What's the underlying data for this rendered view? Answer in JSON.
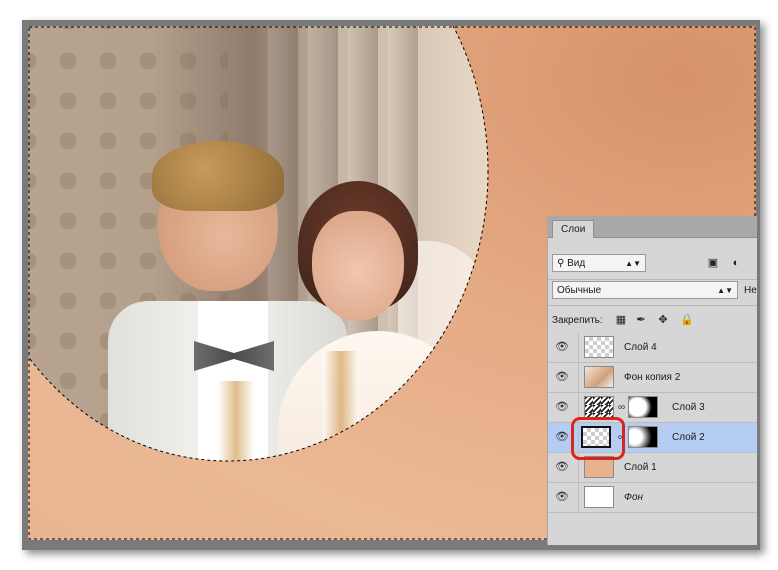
{
  "colors": {
    "highlight": "#d9261c",
    "selected_row": "#b5cdf3",
    "panel_bg": "#d6d6d6",
    "canvas_bg": "#e9b491"
  },
  "panel": {
    "tab_label": "Слои",
    "filter_label": "Вид",
    "blend_mode": "Обычные",
    "opacity_label_partial": "Не",
    "lock_label": "Закрепить:",
    "layers": [
      {
        "name": "Слой 4",
        "thumb": "checker",
        "selected": false,
        "italic": false,
        "icon": "eye-icon"
      },
      {
        "name": "Фон копия 2",
        "thumb": "photo",
        "selected": false,
        "italic": false,
        "icon": "eye-icon"
      },
      {
        "name": "Слой 3",
        "thumb": "pattern-with-mask",
        "selected": false,
        "italic": false,
        "icon": "eye-icon"
      },
      {
        "name": "Слой 2",
        "thumb": "checker-with-mask",
        "selected": true,
        "italic": false,
        "icon": "eye-icon"
      },
      {
        "name": "Слой 1",
        "thumb": "peach",
        "selected": false,
        "italic": false,
        "icon": "eye-icon"
      },
      {
        "name": "Фон",
        "thumb": "white",
        "selected": false,
        "italic": true,
        "icon": "eye-icon"
      }
    ]
  }
}
